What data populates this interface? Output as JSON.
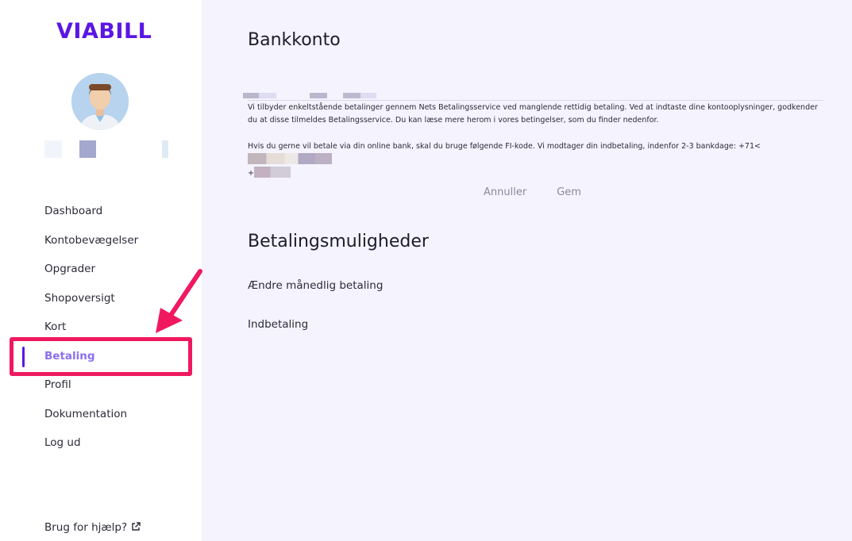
{
  "brand": {
    "logo_text": "VIABILL",
    "accent": "#5b16e4"
  },
  "sidebar": {
    "items": [
      {
        "label": "Dashboard",
        "name": "sidebar-item-dashboard",
        "active": false
      },
      {
        "label": "Kontobevægelser",
        "name": "sidebar-item-kontobevaegelser",
        "active": false
      },
      {
        "label": "Opgrader",
        "name": "sidebar-item-opgrader",
        "active": false
      },
      {
        "label": "Shopoversigt",
        "name": "sidebar-item-shopoversigt",
        "active": false
      },
      {
        "label": "Kort",
        "name": "sidebar-item-kort",
        "active": false
      },
      {
        "label": "Betaling",
        "name": "sidebar-item-betaling",
        "active": true
      },
      {
        "label": "Profil",
        "name": "sidebar-item-profil",
        "active": false
      },
      {
        "label": "Dokumentation",
        "name": "sidebar-item-dokumentation",
        "active": false
      },
      {
        "label": "Log ud",
        "name": "sidebar-item-log-ud",
        "active": false
      }
    ],
    "help_label": "Brug for hjælp?",
    "help_icon": "external-link-icon"
  },
  "annotation": {
    "highlight_color": "#f0195f",
    "arrow_icon": "arrow-pointer-icon"
  },
  "bank": {
    "title": "Bankkonto",
    "info_1": "Vi tilbyder enkeltstående betalinger gennem Nets Betalingsservice ved manglende rettidig betaling. Ved at indtaste dine kontooplysninger, godkender du at disse tilmeldes Betalingsservice. Du kan læse mere herom i vores betingelser, som du finder nedenfor.",
    "info_2_prefix": "Hvis du gerne vil betale via din online bank, skal du bruge følgende FI-kode. Vi modtager din indbetaling, indenfor 2-3 bankdage: +71<",
    "info_2_line2_prefix": "+",
    "cancel_label": "Annuller",
    "save_label": "Gem"
  },
  "payment_options": {
    "title": "Betalingsmuligheder",
    "change_monthly_label": "Ændre månedlig betaling",
    "deposit_label": "Indbetaling"
  }
}
